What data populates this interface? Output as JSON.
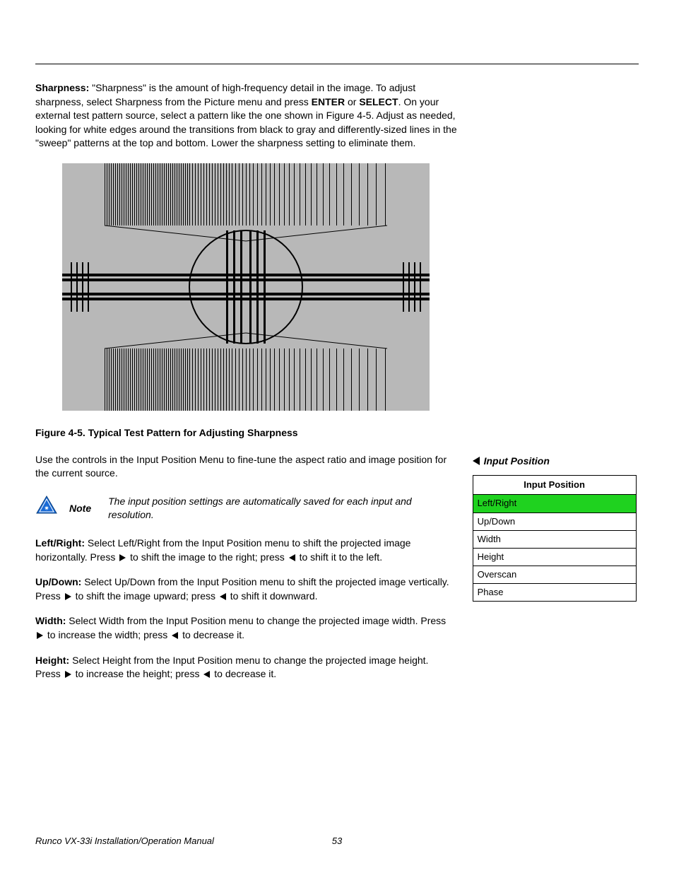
{
  "sharpness": {
    "label": "Sharpness:",
    "text1": " \"Sharpness\" is the amount of high-frequency detail in the image. To adjust sharpness, select Sharpness from the Picture menu and press ",
    "enter": "ENTER",
    "or": " or ",
    "select": "SELECT",
    "text2": ". On your external test pattern source, select a pattern like the one shown in Figure 4-5. Adjust as needed, looking for white edges around the transitions from black to gray and differently-sized lines in the \"sweep\" patterns at the top and bottom. Lower the sharpness setting to eliminate them."
  },
  "figure_caption": "Figure 4-5. Typical Test Pattern for Adjusting Sharpness",
  "input_position_intro": "Use the controls in the Input Position Menu to fine-tune the aspect ratio and image position for the current source.",
  "side_heading": "Input Position",
  "note": {
    "label": "Note",
    "text": "The input position settings are automatically saved for each input and resolution."
  },
  "menu": {
    "title": "Input Position",
    "items": [
      "Left/Right",
      "Up/Down",
      "Width",
      "Height",
      "Overscan",
      "Phase"
    ],
    "selected_index": 0
  },
  "paragraphs": {
    "leftright": {
      "label": "Left/Right:",
      "t1": " Select Left/Right from the Input Position menu to shift the projected image horizontally. Press ",
      "t2": " to shift the image to the right; press ",
      "t3": " to shift it to the left."
    },
    "updown": {
      "label": "Up/Down:",
      "t1": " Select Up/Down from the Input Position menu to shift the projected image vertically. Press ",
      "t2": " to shift the image upward; press ",
      "t3": " to shift it downward."
    },
    "width": {
      "label": "Width:",
      "t1": " Select Width from the Input Position menu to change the projected image width. Press ",
      "t2": " to increase the width; press ",
      "t3": " to decrease it."
    },
    "height": {
      "label": "Height:",
      "t1": " Select Height from the Input Position menu to change the projected image height. Press ",
      "t2": " to increase the height; press ",
      "t3": " to decrease it."
    }
  },
  "footer": {
    "title": "Runco VX-33i Installation/Operation Manual",
    "page": "53"
  }
}
